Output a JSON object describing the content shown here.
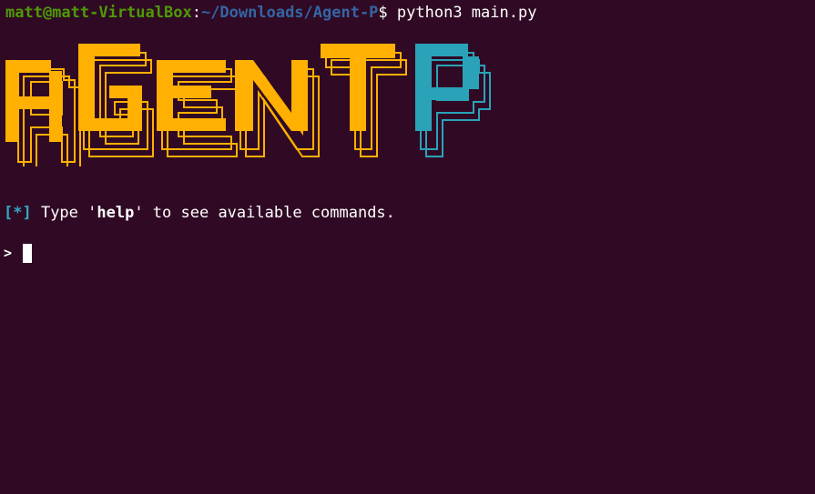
{
  "terminal": {
    "prompt_user": "matt@matt-VirtualBox",
    "prompt_sep": ":",
    "prompt_path": "~/Downloads/Agent-P",
    "prompt_symbol": "$ ",
    "command": "python3 main.py"
  },
  "banner": {
    "text": "AGENT P",
    "primary_color": "#ffb000",
    "accent_color": "#2aa3b8"
  },
  "help_line": {
    "marker": "[*]",
    "before": " Type '",
    "keyword": "help",
    "after": "' to see available commands."
  },
  "input_line": {
    "prompt": ">"
  },
  "colors": {
    "background": "#300a24",
    "user": "#4e9a06",
    "path": "#3465a4"
  }
}
